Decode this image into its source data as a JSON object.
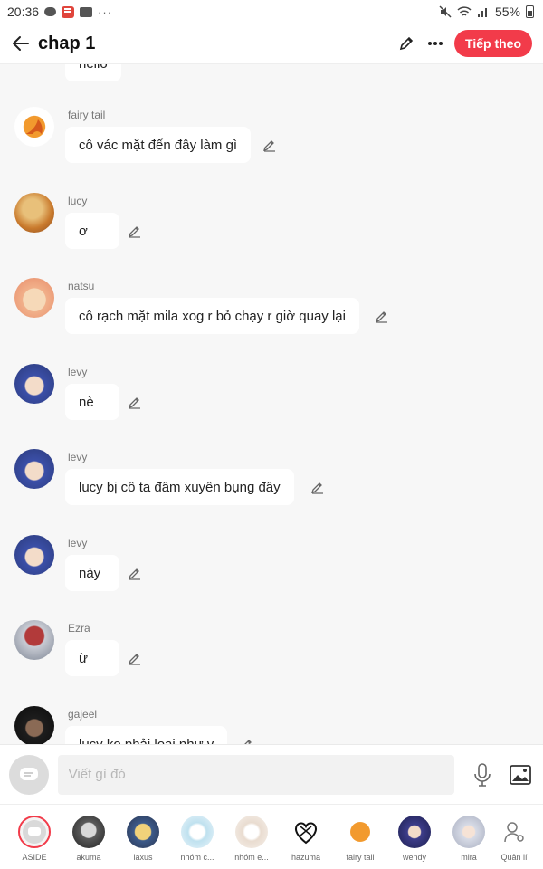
{
  "status_bar": {
    "time": "20:36",
    "dots": "···",
    "battery": "55%"
  },
  "header": {
    "title": "chap 1",
    "next_label": "Tiếp theo"
  },
  "chat": {
    "partial_top_text": "hello",
    "messages": [
      {
        "name": "fairy tail",
        "text": "cô vác mặt đến đây làm gì"
      },
      {
        "name": "lucy",
        "text": "ơ"
      },
      {
        "name": "natsu",
        "text": "cô rạch mặt mila xog r bỏ chạy r giờ quay lại"
      },
      {
        "name": "levy",
        "text": "nè"
      },
      {
        "name": "levy",
        "text": "lucy bị cô ta đâm xuyên bụng đây"
      },
      {
        "name": "levy",
        "text": "này"
      },
      {
        "name": "Ezra",
        "text": "ừ"
      },
      {
        "name": "gajeel",
        "text": "lucy ko phải loại như v"
      }
    ]
  },
  "composer": {
    "placeholder": "Viết gì đó"
  },
  "characters": [
    {
      "label": "ASIDE"
    },
    {
      "label": "akuma"
    },
    {
      "label": "laxus"
    },
    {
      "label": "nhóm c..."
    },
    {
      "label": "nhóm e..."
    },
    {
      "label": "hazuma"
    },
    {
      "label": "fairy tail"
    },
    {
      "label": "wendy"
    },
    {
      "label": "mira"
    },
    {
      "label": "Quản lí"
    }
  ],
  "colors": {
    "accent": "#f23b4a",
    "background": "#f7f7f7",
    "bubble": "#ffffff"
  }
}
